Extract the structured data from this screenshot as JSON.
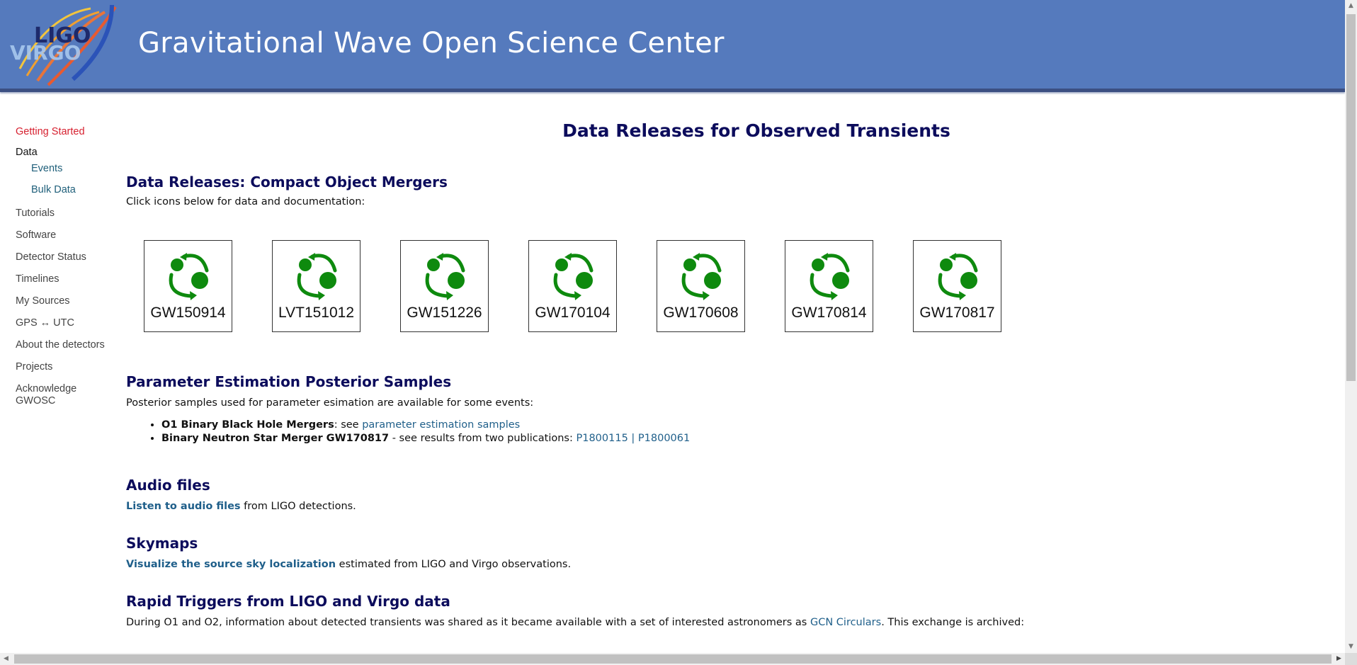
{
  "header": {
    "logo": {
      "top_text": "LIGO",
      "bottom_text": "VIRGO"
    },
    "title": "Gravitational Wave Open Science Center",
    "background_color": "#557abd"
  },
  "sidebar": {
    "items": [
      {
        "label": "Getting Started",
        "state": "active"
      },
      {
        "label": "Data",
        "state": "plain"
      },
      {
        "label": "Events",
        "state": "sub"
      },
      {
        "label": "Bulk Data",
        "state": "sub"
      },
      {
        "label": "Tutorials",
        "state": "normal"
      },
      {
        "label": "Software",
        "state": "normal"
      },
      {
        "label": "Detector Status",
        "state": "normal"
      },
      {
        "label": "Timelines",
        "state": "normal"
      },
      {
        "label": "My Sources",
        "state": "normal"
      },
      {
        "label": "GPS ↔ UTC",
        "state": "normal"
      },
      {
        "label": "About the detectors",
        "state": "normal"
      },
      {
        "label": "Projects",
        "state": "normal"
      },
      {
        "label": "Acknowledge GWOSC",
        "state": "normal"
      }
    ]
  },
  "main": {
    "page_title": "Data Releases for Observed Transients",
    "mergers": {
      "heading": "Data Releases: Compact Object Mergers",
      "intro": "Click icons below for data and documentation:",
      "events": [
        {
          "label": "GW150914",
          "icon": "binary-merger-icon"
        },
        {
          "label": "LVT151012",
          "icon": "binary-merger-icon"
        },
        {
          "label": "GW151226",
          "icon": "binary-merger-icon"
        },
        {
          "label": "GW170104",
          "icon": "binary-merger-icon"
        },
        {
          "label": "GW170608",
          "icon": "binary-merger-icon"
        },
        {
          "label": "GW170814",
          "icon": "binary-merger-icon"
        },
        {
          "label": "GW170817",
          "icon": "binary-merger-icon"
        }
      ],
      "icon_color": "#0e8a0e"
    },
    "posterior": {
      "heading": "Parameter Estimation Posterior Samples",
      "intro": "Posterior samples used for parameter esimation are available for some events:",
      "items": [
        {
          "bold": "O1 Binary Black Hole Mergers",
          "text": ": see ",
          "link": "parameter estimation samples"
        },
        {
          "bold": "Binary Neutron Star Merger GW170817",
          "text": " - see results from two publications: ",
          "link1": "P1800115",
          "separator": " | ",
          "link2": "P1800061"
        }
      ]
    },
    "audio": {
      "heading": "Audio files",
      "link": "Listen to audio files",
      "text": " from LIGO detections."
    },
    "skymaps": {
      "heading": "Skymaps",
      "link": "Visualize the source sky localization",
      "text": " estimated from LIGO and Virgo observations."
    },
    "rapid": {
      "heading": "Rapid Triggers from LIGO and Virgo data",
      "text_before": "During O1 and O2, information about detected transients was shared as it became available with a set of interested astronomers as ",
      "link": "GCN Circulars",
      "text_after": ". This exchange is archived:"
    }
  },
  "colors": {
    "heading": "#0c0c5c",
    "link": "#1f5f8a",
    "active_nav": "#d6202f"
  }
}
